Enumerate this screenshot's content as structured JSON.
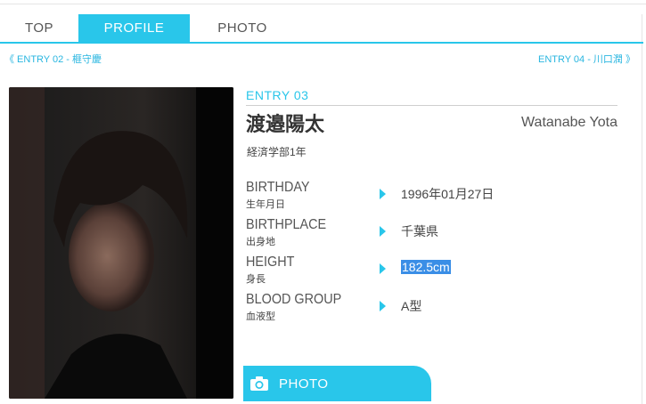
{
  "tabs": [
    {
      "label": "TOP",
      "active": false
    },
    {
      "label": "PROFILE",
      "active": true
    },
    {
      "label": "PHOTO",
      "active": false
    }
  ],
  "nav": {
    "prev": "《 ENTRY 02 - 榧守慶",
    "next": "ENTRY 04 - 川口潤 》"
  },
  "profile": {
    "entry": "ENTRY 03",
    "name_jp": "渡邉陽太",
    "name_en": "Watanabe Yota",
    "faculty": "経済学部1年",
    "rows": [
      {
        "label_en": "BIRTHDAY",
        "label_jp": "生年月日",
        "value": "1996年01月27日"
      },
      {
        "label_en": "BIRTHPLACE",
        "label_jp": "出身地",
        "value": "千葉県"
      },
      {
        "label_en": "HEIGHT",
        "label_jp": "身長",
        "value": "182.5cm",
        "selected": true
      },
      {
        "label_en": "BLOOD GROUP",
        "label_jp": "血液型",
        "value": "A型"
      }
    ]
  },
  "photo_button": {
    "label": "PHOTO",
    "icon": "camera-icon"
  },
  "colors": {
    "accent": "#29c6ea",
    "selection": "#3a8ee6"
  }
}
